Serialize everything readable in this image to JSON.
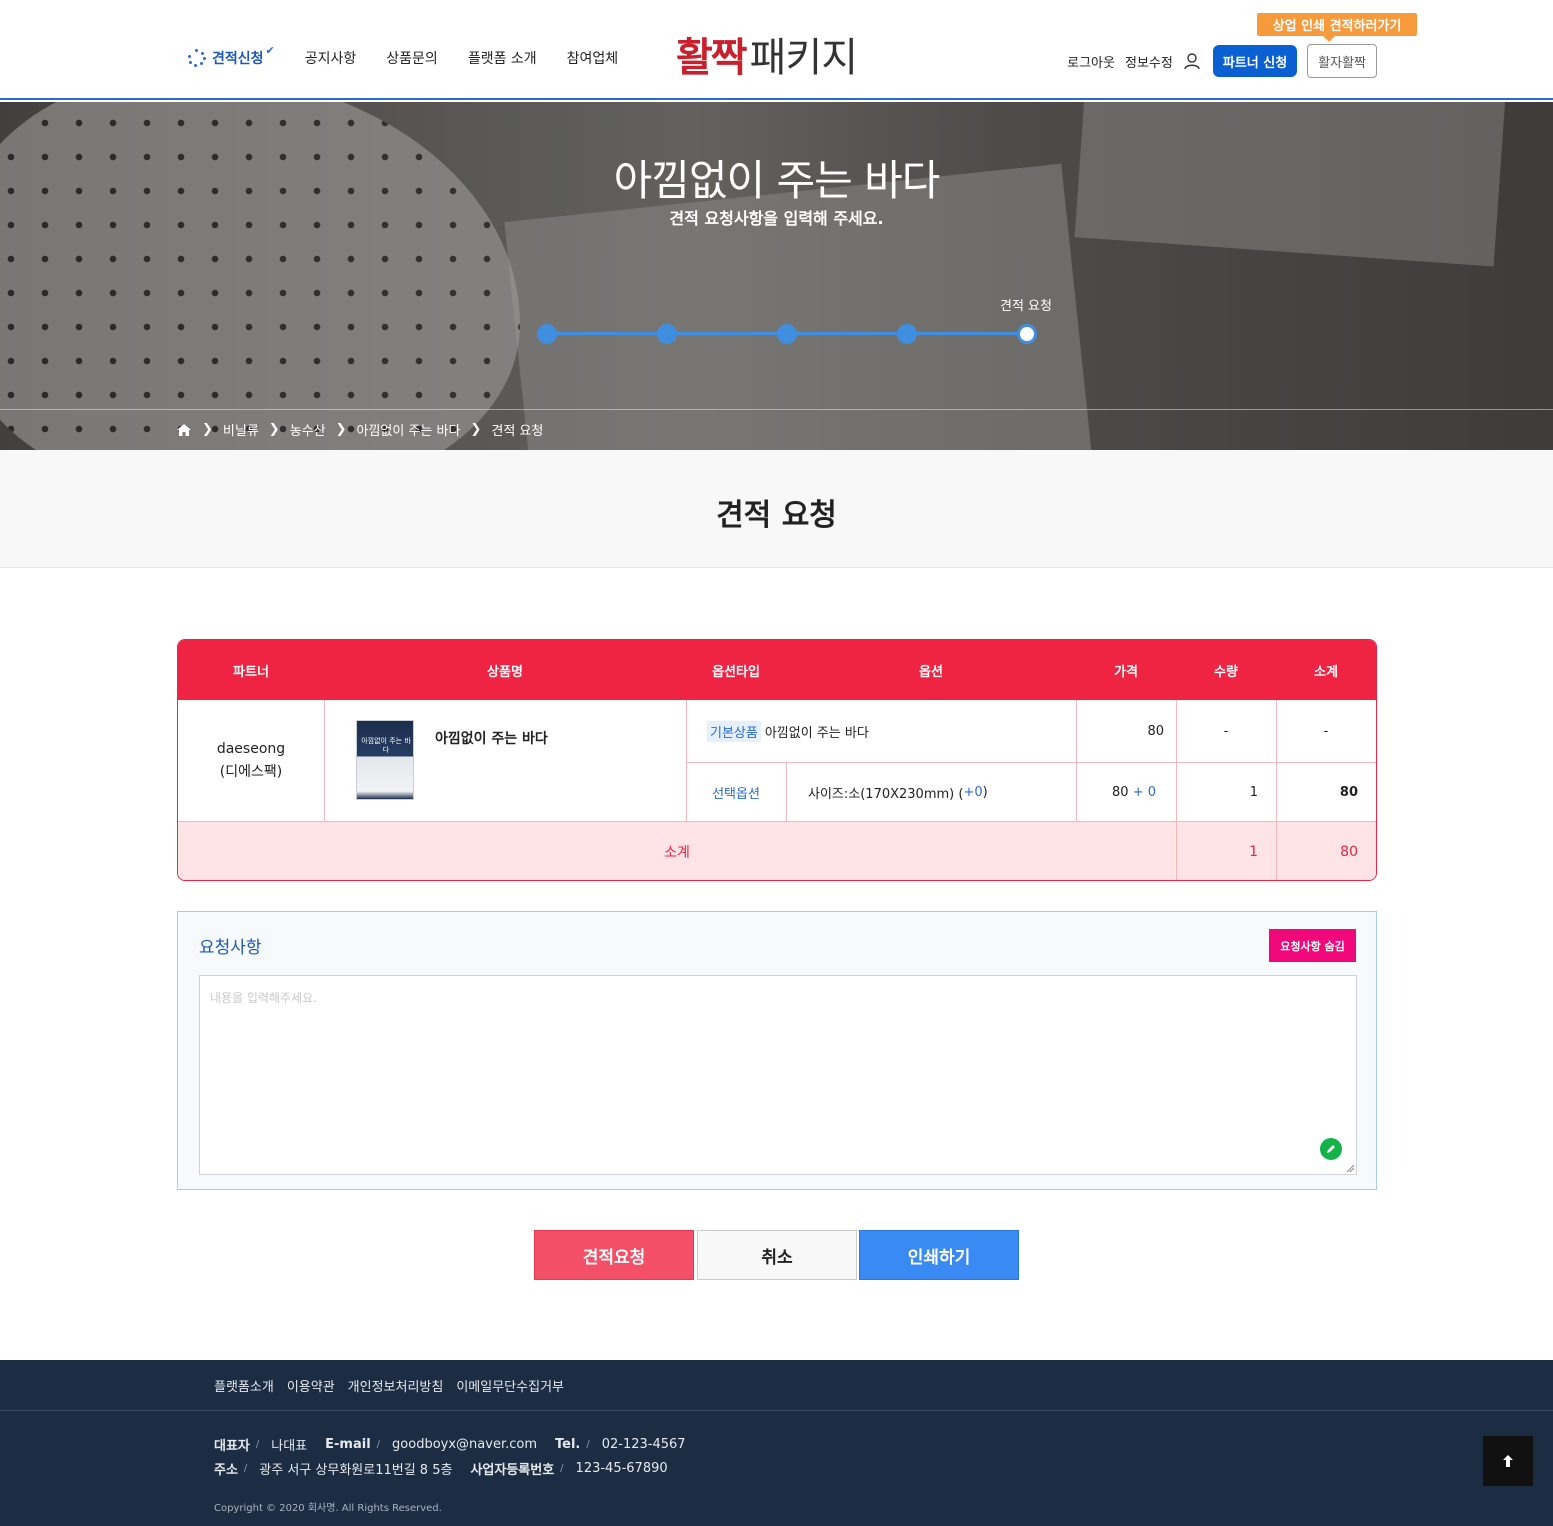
{
  "header": {
    "nav": [
      "견적신청",
      "공지사항",
      "상품문의",
      "플랫폼 소개",
      "참여업체"
    ],
    "logo_a": "활짝",
    "logo_b": "패키지",
    "logout": "로그아웃",
    "edit_info": "정보수정",
    "partner_btn": "파트너 신청",
    "hwal_btn": "활자활짝",
    "promo_badge": "상업 인쇄 견적하러가기"
  },
  "hero": {
    "title": "아낌없이 주는 바다",
    "subtitle": "견적 요청사항을 입력해 주세요.",
    "step_label": "견적 요청",
    "steps_total": 5,
    "current_step": 5
  },
  "breadcrumb": [
    "비닐류",
    "농수산",
    "아낌없이 주는 바다",
    "견적 요청"
  ],
  "page_title": "견적 요청",
  "table": {
    "headers": [
      "파트너",
      "상품명",
      "옵션타입",
      "옵션",
      "가격",
      "수량",
      "소계"
    ],
    "partner_line1": "daeseong",
    "partner_line2": "(디에스팩)",
    "product_thumb_text": "아낌없이 주는 바다",
    "product_name": "아낌없이 주는 바다",
    "row1": {
      "tag": "기본상품",
      "option": "아낌없이 주는 바다",
      "price": "80",
      "qty": "-",
      "subtotal": "-"
    },
    "row2": {
      "type": "선택옵션",
      "option_main": "사이즈:소(170X230mm) (",
      "option_extra": "+0",
      "option_close": ")",
      "price_main": "80",
      "price_extra": "+ 0",
      "qty": "1",
      "subtotal": "80"
    },
    "sum_label": "소계",
    "sum_qty": "1",
    "sum_total": "80"
  },
  "request": {
    "title": "요청사항",
    "hide_btn": "요청사항 숨김",
    "placeholder": "내용을 입력해주세요."
  },
  "buttons": {
    "request": "견적요청",
    "cancel": "취소",
    "print": "인쇄하기"
  },
  "footer": {
    "links": [
      "플랫폼소개",
      "이용약관",
      "개인정보처리방침",
      "이메일무단수집거부"
    ],
    "rep_label": "대표자",
    "rep": "나대표",
    "email_label": "E-mail",
    "email": "goodboyx@naver.com",
    "tel_label": "Tel.",
    "tel": "02-123-4567",
    "addr_label": "주소",
    "addr": "광주 서구 상무화원로11번길 8 5층",
    "biz_label": "사업자등록번호",
    "biz": "123-45-67890",
    "slash": "/",
    "copyright": "Copyright © 2020 회사명. All Rights Reserved."
  },
  "colors": {
    "accent_red": "#ef2442",
    "accent_blue": "#0a5fd1",
    "footer_bg": "#1c2d43",
    "badge_pink": "#f0087a",
    "promo_orange": "#f79a3c"
  }
}
